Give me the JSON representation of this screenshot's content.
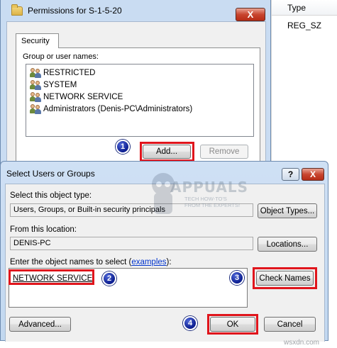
{
  "registry": {
    "column_header": "Type",
    "row_value": "REG_SZ"
  },
  "permissions_dialog": {
    "title": "Permissions for S-1-5-20",
    "close_glyph": "X",
    "tab_security": "Security",
    "group_label": "Group or user names:",
    "users": [
      "RESTRICTED",
      "SYSTEM",
      "NETWORK SERVICE",
      "Administrators (Denis-PC\\Administrators)"
    ],
    "add_button": "Add...",
    "remove_button": "Remove"
  },
  "select_dialog": {
    "title": "Select Users or Groups",
    "help_glyph": "?",
    "close_glyph": "X",
    "object_type_label": "Select this object type:",
    "object_type_value": "Users, Groups, or Built-in security principals",
    "object_types_button": "Object Types...",
    "location_label": "From this location:",
    "location_value": "DENIS-PC",
    "locations_button": "Locations...",
    "names_label_prefix": "Enter the object names to select (",
    "names_label_link": "examples",
    "names_label_suffix": "):",
    "names_value": "NETWORK SERVICE",
    "check_names_button": "Check Names",
    "advanced_button": "Advanced...",
    "ok_button": "OK",
    "cancel_button": "Cancel"
  },
  "steps": [
    "1",
    "2",
    "3",
    "4"
  ],
  "watermark": {
    "brand": "APPUALS",
    "tagline": "TECH HOW-TO'S FROM THE EXPERTS!",
    "site": "wsxdn.com"
  },
  "colors": {
    "highlight_red": "#e0151c",
    "badge_blue": "#0b1d8f",
    "dialog_frame": "#c9dcf2",
    "link_blue": "#0033cc"
  },
  "icons": {
    "folder": "folder-icon",
    "users": "users-group-icon"
  }
}
